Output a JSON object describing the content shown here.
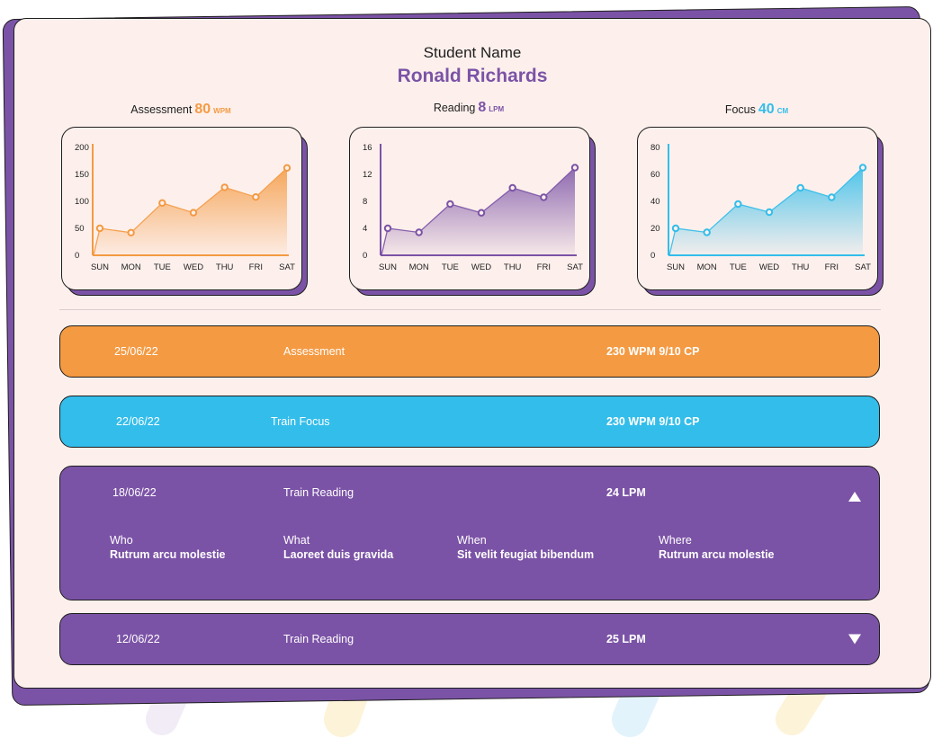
{
  "header": {
    "label": "Student Name",
    "name": "Ronald Richards"
  },
  "colors": {
    "orange": "#f49a42",
    "purple": "#7b53a6",
    "blue": "#33bdea",
    "card": "#fdf0ec",
    "ink": "#1e1e1e"
  },
  "metrics": [
    {
      "label": "Assessment",
      "value": "80",
      "unit": "WPM",
      "color": "#f49a42"
    },
    {
      "label": "Reading",
      "value": "8",
      "unit": "LPM",
      "color": "#7b53a6"
    },
    {
      "label": "Focus",
      "value": "40",
      "unit": "CM",
      "color": "#33bdea"
    }
  ],
  "chart_data": [
    {
      "type": "area",
      "categories": [
        "SUN",
        "MON",
        "TUE",
        "WED",
        "THU",
        "FRI",
        "SAT"
      ],
      "values": [
        50,
        42,
        97,
        79,
        126,
        108,
        162
      ],
      "ylim": [
        0,
        200
      ],
      "yticks": [
        0,
        50,
        100,
        150,
        200
      ],
      "color": "#f49a42",
      "grid": false
    },
    {
      "type": "area",
      "categories": [
        "SUN",
        "MON",
        "TUE",
        "WED",
        "THU",
        "FRI",
        "SAT"
      ],
      "values": [
        4,
        3.4,
        7.6,
        6.3,
        10,
        8.6,
        13
      ],
      "ylim": [
        0,
        16
      ],
      "yticks": [
        0,
        4,
        8,
        12,
        16
      ],
      "color": "#7b53a6",
      "grid": false
    },
    {
      "type": "area",
      "categories": [
        "SUN",
        "MON",
        "TUE",
        "WED",
        "THU",
        "FRI",
        "SAT"
      ],
      "values": [
        20,
        17,
        38,
        32,
        50,
        43,
        65
      ],
      "ylim": [
        0,
        80
      ],
      "yticks": [
        0,
        20,
        40,
        60,
        80
      ],
      "color": "#33bdea",
      "grid": false
    }
  ],
  "sessions": [
    {
      "date": "25/06/22",
      "activity": "Assessment",
      "result": "230 WPM 9/10 CP",
      "color": "#f49a42"
    },
    {
      "date": "22/06/22",
      "activity": "Train Focus",
      "result": "230 WPM 9/10 CP",
      "color": "#33bdea"
    },
    {
      "date": "18/06/22",
      "activity": "Train Reading",
      "result": "24 LPM",
      "color": "#7b53a6",
      "details": [
        {
          "title": "Who",
          "value": "Rutrum arcu molestie"
        },
        {
          "title": "What",
          "value": "Laoreet duis gravida"
        },
        {
          "title": "When",
          "value": "Sit velit feugiat bibendum"
        },
        {
          "title": "Where",
          "value": "Rutrum arcu molestie"
        }
      ]
    },
    {
      "date": "12/06/22",
      "activity": "Train Reading",
      "result": "25 LPM",
      "color": "#7b53a6"
    }
  ]
}
